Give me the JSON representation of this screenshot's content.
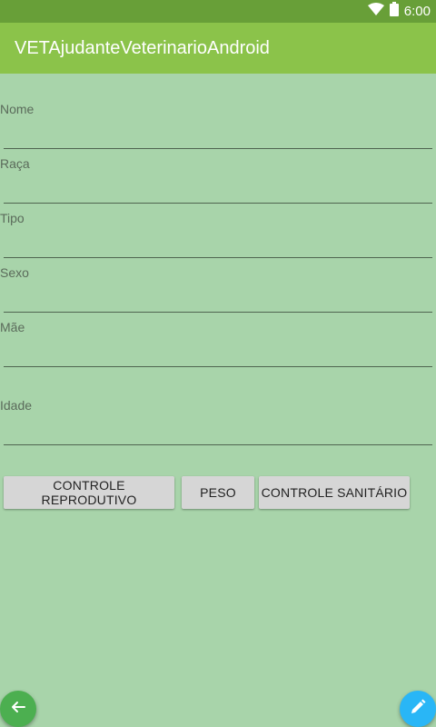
{
  "status_bar": {
    "time": "6:00",
    "wifi_icon": "wifi-icon",
    "battery_icon": "battery-icon"
  },
  "app_bar": {
    "title": "VETAjudanteVeterinarioAndroid"
  },
  "form": {
    "fields": [
      {
        "label": "Nome",
        "value": ""
      },
      {
        "label": "Raça",
        "value": ""
      },
      {
        "label": "Tipo",
        "value": ""
      },
      {
        "label": "Sexo",
        "value": ""
      },
      {
        "label": "Mãe",
        "value": ""
      },
      {
        "label": "Idade",
        "value": ""
      }
    ]
  },
  "buttons": {
    "controle_reprodutivo": "CONTROLE REPRODUTIVO",
    "peso": "PESO",
    "controle_sanitario": "CONTROLE SANITÁRIO"
  },
  "fabs": {
    "back_icon": "arrow-left-icon",
    "edit_icon": "pencil-icon"
  },
  "colors": {
    "status_bar": "#689f38",
    "app_bar": "#8bc34a",
    "background": "#a8d4aa",
    "fab_back": "#4caf50",
    "fab_edit": "#29b6f6"
  }
}
